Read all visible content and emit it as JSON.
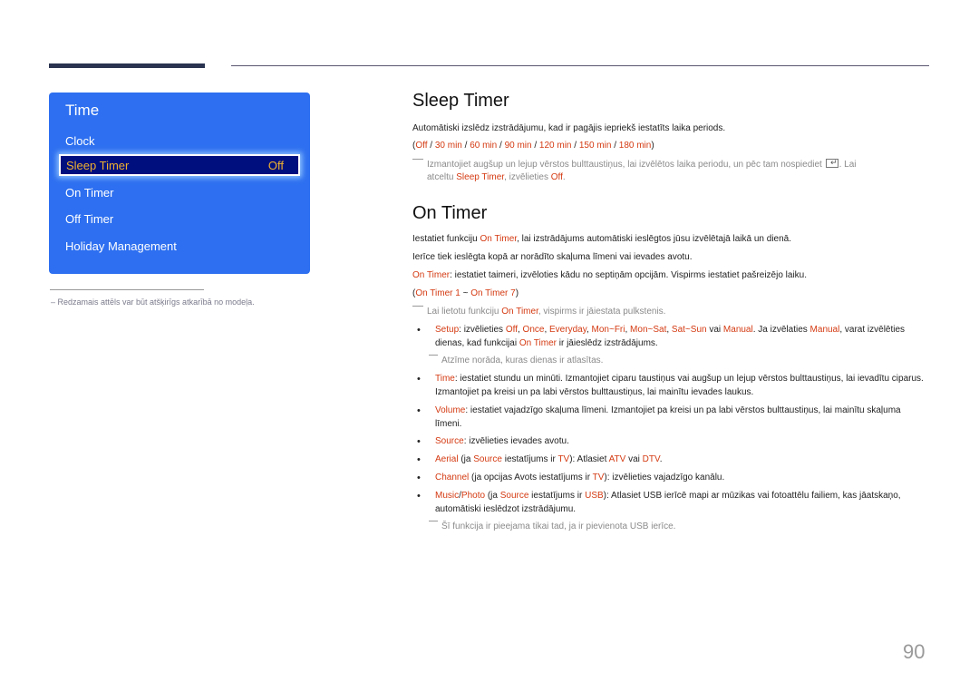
{
  "menu": {
    "title": "Time",
    "items": [
      {
        "label": "Clock"
      },
      {
        "label": "Sleep Timer",
        "value": "Off",
        "selected": true
      },
      {
        "label": "On Timer"
      },
      {
        "label": "Off Timer"
      },
      {
        "label": "Holiday Management"
      }
    ],
    "colors": {
      "panel": "#2d6ff0",
      "selected_bg": "#000f7e",
      "selected_text": "#f0b030"
    }
  },
  "footnote": "–  Redzamais attēls var būt atšķirīgs atkarībā no modeļa.",
  "sleep_timer": {
    "heading": "Sleep Timer",
    "desc": "Automātiski izslēdz izstrādājumu, kad ir pagājis iepriekš iestatīts laika periods.",
    "options": [
      "Off",
      "30 min",
      "60 min",
      "90 min",
      "120 min",
      "150 min",
      "180 min"
    ],
    "note_a": "Izmantojiet augšup un lejup vērstos bulttaustiņus, lai izvēlētos laika periodu, un pēc tam nospiediet",
    "note_b": ". Lai",
    "note_c": "atceltu",
    "note_d": "Sleep Timer",
    "note_e": ", izvēlieties",
    "note_f": "Off",
    "note_g": "."
  },
  "on_timer": {
    "heading": "On Timer",
    "p1_a": "Iestatiet funkciju",
    "p1_b": "On Timer",
    "p1_c": ", lai izstrādājums automātiski ieslēgtos jūsu izvēlētajā laikā un dienā.",
    "p2": "Ierīce tiek ieslēgta kopā ar norādīto skaļuma līmeni vai ievades avotu.",
    "p3_a": "On Timer",
    "p3_b": ": iestatiet taimeri, izvēloties kādu no septiņām opcijām. Vispirms iestatiet pašreizējo laiku.",
    "range_a": "On Timer 1",
    "range_sep": " ~ ",
    "range_b": "On Timer 7",
    "note1_a": "Lai lietotu funkciju",
    "note1_b": "On Timer",
    "note1_c": ", vispirms ir jāiestata pulkstenis.",
    "setup": {
      "label": "Setup",
      "t1": ": izvēlieties ",
      "opts": [
        "Off",
        "Once",
        "Everyday",
        "Mon~Fri",
        "Mon~Sat",
        "Sat~Sun"
      ],
      "t2": " vai ",
      "manual": "Manual",
      "t3": ". Ja izvēlaties ",
      "t4": ", varat izvēlēties dienas, kad funkcijai ",
      "ontimer": "On Timer",
      "t5": " ir jāieslēdz izstrādājums."
    },
    "setup_note": "Atzīme norāda, kuras dienas ir atlasītas.",
    "time": {
      "label": "Time",
      "text": ": iestatiet stundu un minūti. Izmantojiet ciparu taustiņus vai augšup un lejup vērstos bulttaustiņus, lai ievadītu ciparus. Izmantojiet pa kreisi un pa labi vērstos bulttaustiņus, lai mainītu ievades laukus."
    },
    "volume": {
      "label": "Volume",
      "text": ": iestatiet vajadzīgo skaļuma līmeni. Izmantojiet pa kreisi un pa labi vērstos bulttaustiņus, lai mainītu skaļuma līmeni."
    },
    "source": {
      "label": "Source",
      "text": ": izvēlieties ievades avotu."
    },
    "aerial": {
      "label": "Aerial",
      "t1": " (ja ",
      "source": "Source",
      "t2": " iestatījums ir ",
      "tv": "TV",
      "t3": "): Atlasiet ",
      "atv": "ATV",
      "t4": " vai ",
      "dtv": "DTV",
      "t5": "."
    },
    "channel": {
      "label": "Channel",
      "t1": " (ja opcijas Avots iestatījums ir ",
      "tv": "TV",
      "t2": "): izvēlieties vajadzīgo kanālu."
    },
    "music": {
      "label": "Music",
      "sep": "/",
      "photo": "Photo",
      "t1": " (ja ",
      "source": "Source",
      "t2": " iestatījums ir ",
      "usb": "USB",
      "t3": "): Atlasiet USB ierīcē mapi ar mūzikas vai fotoattēlu failiem, kas jāatskaņo, automātiski ieslēdzot izstrādājumu."
    },
    "usb_note": "Šī funkcija ir pieejama tikai tad, ja ir pievienota USB ierīce."
  },
  "page_number": "90",
  "colors": {
    "highlight": "#d43a12",
    "text": "#222222",
    "note": "#8a8a8a"
  }
}
